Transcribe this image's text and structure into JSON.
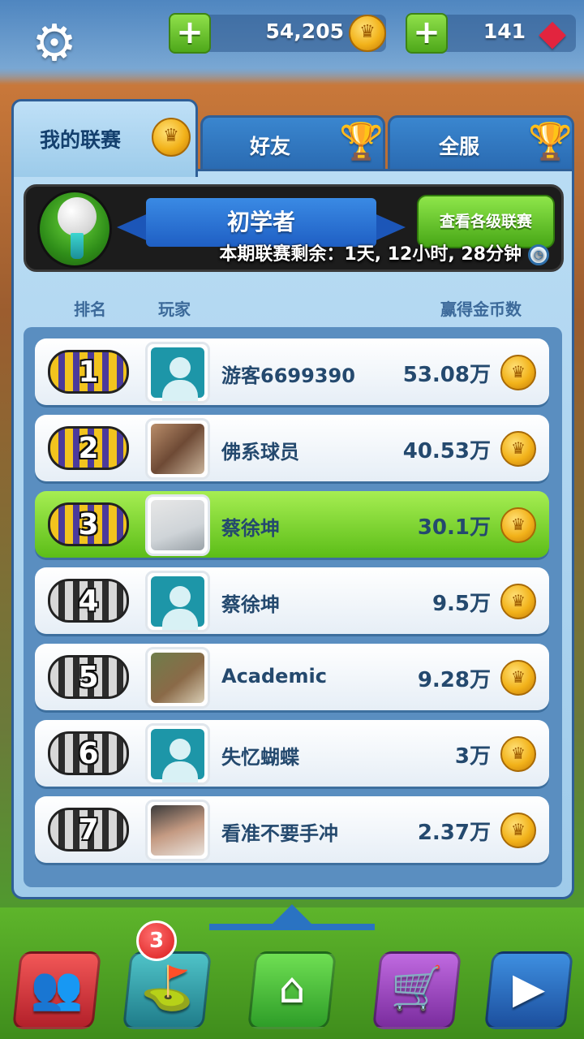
{
  "currency": {
    "coins": "54,205",
    "gems": "141"
  },
  "tabs": [
    {
      "label": "我的联赛"
    },
    {
      "label": "好友"
    },
    {
      "label": "全服"
    }
  ],
  "league": {
    "name": "初学者",
    "view_button": "查看各级联赛",
    "timer": "本期联赛剩余：1天, 12小时, 28分钟"
  },
  "columns": {
    "rank": "排名",
    "player": "玩家",
    "coins": "赢得金币数"
  },
  "rows": [
    {
      "rank": "1",
      "name": "游客6699390",
      "coins": "53.08万",
      "medal": "gold",
      "avatar": "default",
      "highlight": false
    },
    {
      "rank": "2",
      "name": "佛系球员",
      "coins": "40.53万",
      "medal": "gold",
      "avatar": "photo",
      "highlight": false
    },
    {
      "rank": "3",
      "name": "蔡徐坤",
      "coins": "30.1万",
      "medal": "gold",
      "avatar": "photo",
      "highlight": true
    },
    {
      "rank": "4",
      "name": "蔡徐坤",
      "coins": "9.5万",
      "medal": "silver",
      "avatar": "default",
      "highlight": false
    },
    {
      "rank": "5",
      "name": "Academic",
      "coins": "9.28万",
      "medal": "silver",
      "avatar": "photo",
      "highlight": false
    },
    {
      "rank": "6",
      "name": "失忆蝴蝶",
      "coins": "3万",
      "medal": "silver",
      "avatar": "default",
      "highlight": false
    },
    {
      "rank": "7",
      "name": "看准不要手冲",
      "coins": "2.37万",
      "medal": "silver",
      "avatar": "photo",
      "highlight": false
    }
  ],
  "nav": {
    "clubs_badge": "3"
  },
  "icons": {
    "settings": "gear-icon",
    "coin": "crown-coin-icon",
    "gem": "ruby-gem-icon",
    "trophy": "trophy-icon"
  },
  "colors": {
    "highlight_row": "#5cbd18",
    "accent_blue": "#2f5f97",
    "gold": "#f2b21a"
  }
}
